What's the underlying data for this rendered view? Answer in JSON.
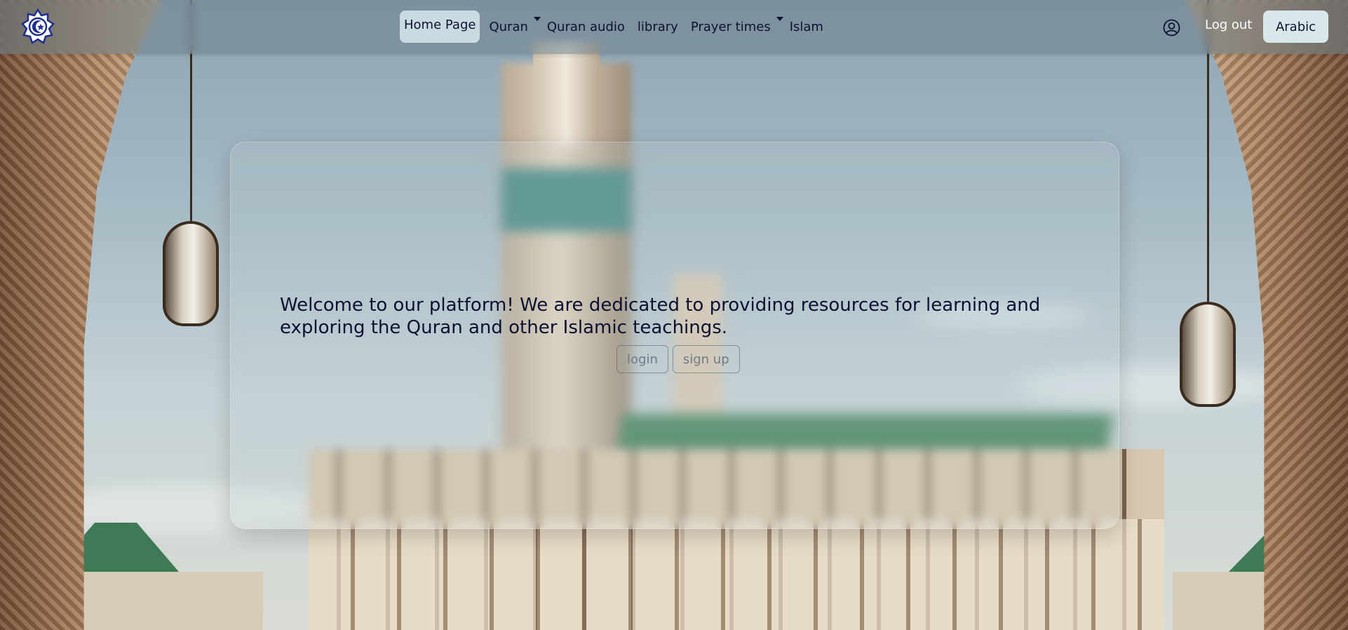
{
  "nav": {
    "logo_icon": "mosque-crescent-logo-icon",
    "items": [
      {
        "label": "Home Page",
        "active": true,
        "dropdown": false
      },
      {
        "label": "Quran",
        "active": false,
        "dropdown": true
      },
      {
        "label": "Quran audio",
        "active": false,
        "dropdown": false
      },
      {
        "label": "library",
        "active": false,
        "dropdown": false
      },
      {
        "label": "Prayer times",
        "active": false,
        "dropdown": true
      },
      {
        "label": "Islam",
        "active": false,
        "dropdown": false
      }
    ],
    "user_icon": "user-circle-icon",
    "logout_label": "Log out",
    "language_label": "Arabic"
  },
  "hero": {
    "welcome_text": "Welcome to our platform! We are dedicated to providing resources for learning and exploring the Quran and other Islamic teachings.",
    "login_label": "login",
    "signup_label": "sign up"
  },
  "colors": {
    "nav_text": "#0e1230",
    "active_pill": "#d8e8ea",
    "welcome_text": "#0c1131",
    "logo_blue": "#1c2f8f"
  }
}
